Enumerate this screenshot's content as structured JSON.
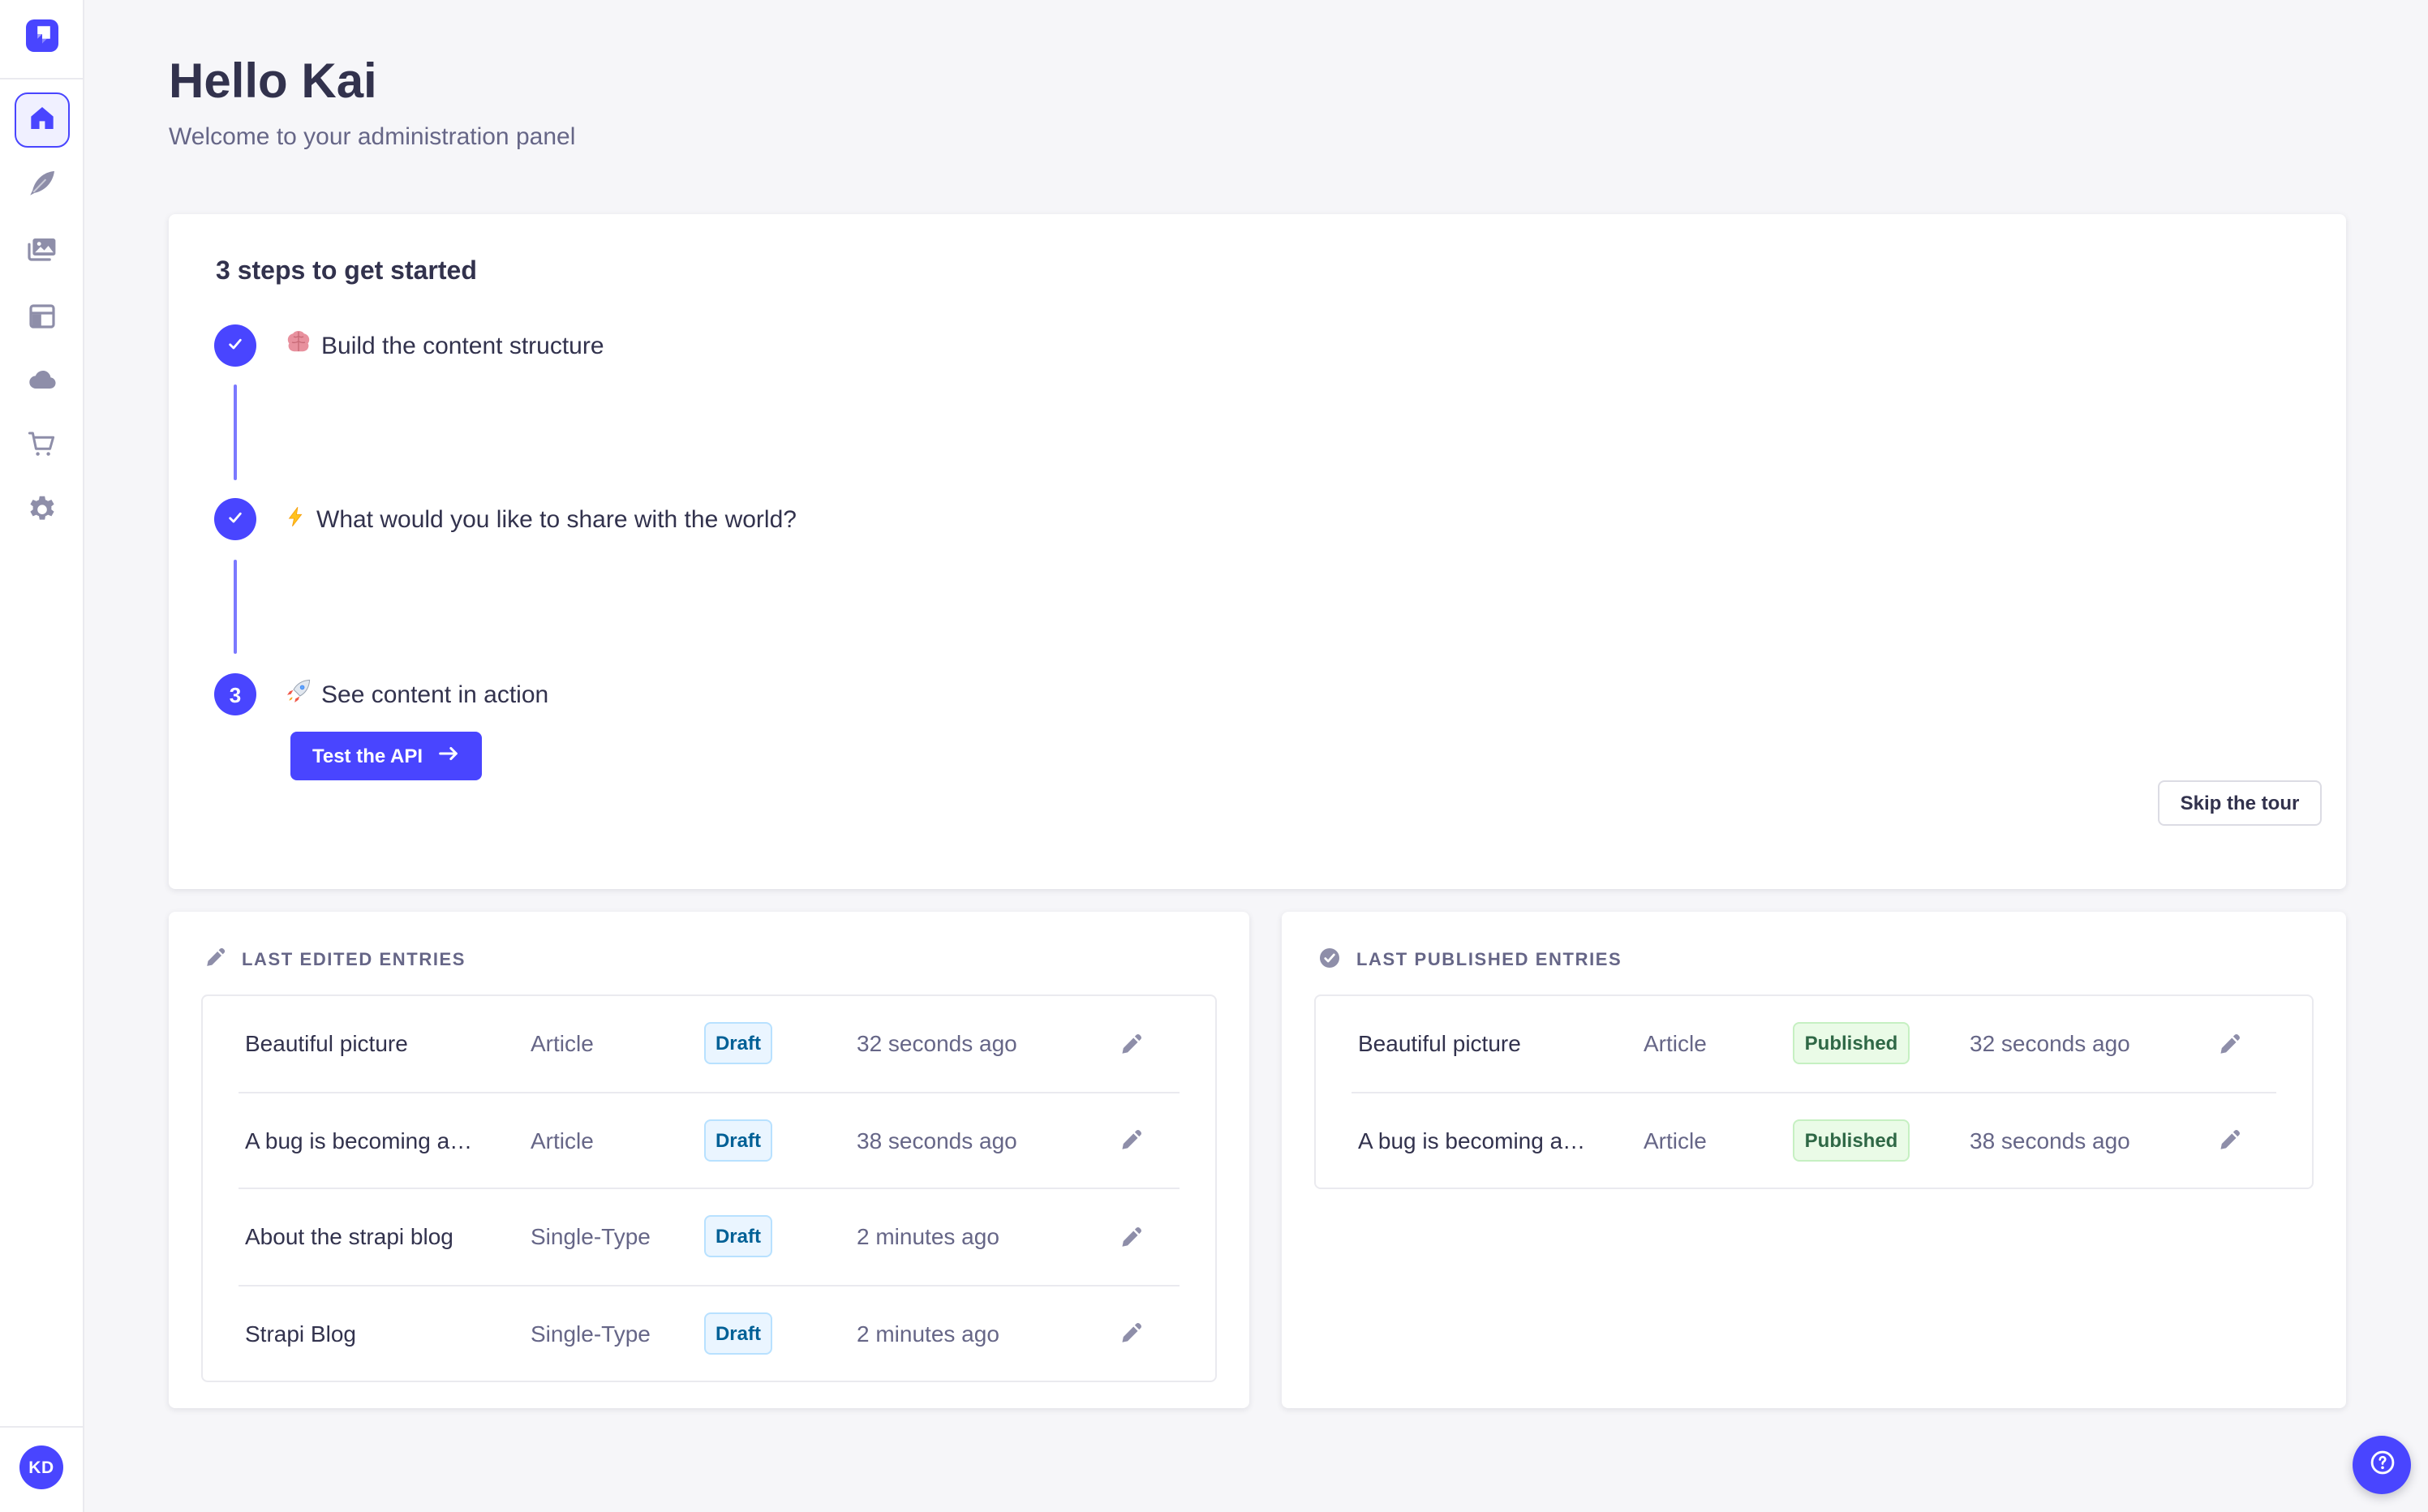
{
  "colors": {
    "primary": "#4945FF",
    "connector": "#7B79FF",
    "background": "#F6F6F9",
    "card": "#FFFFFF",
    "border": "#EAEAEF",
    "text_dark": "#32324D",
    "text_muted": "#666687",
    "icon_muted": "#8E8EA9",
    "draft_bg": "#EAF5FF",
    "draft_border": "#B8E1FF",
    "draft_text": "#006096",
    "published_bg": "#EAFBE7",
    "published_border": "#C6F0C2",
    "published_text": "#2F6846"
  },
  "sidebar": {
    "logo_icon": "strapi-logo-icon",
    "avatar_initials": "KD",
    "items": [
      {
        "icon": "home-icon",
        "active": true
      },
      {
        "icon": "feather-icon",
        "active": false
      },
      {
        "icon": "media-icon",
        "active": false
      },
      {
        "icon": "layout-icon",
        "active": false
      },
      {
        "icon": "cloud-icon",
        "active": false
      },
      {
        "icon": "cart-icon",
        "active": false
      },
      {
        "icon": "gear-icon",
        "active": false
      }
    ]
  },
  "header": {
    "title": "Hello Kai",
    "subtitle": "Welcome to your administration panel"
  },
  "onboarding": {
    "title": "3 steps to get started",
    "steps": [
      {
        "state": "done",
        "emoji": "🧠",
        "emoji_icon": "brain-emoji-icon",
        "label": "Build the content structure"
      },
      {
        "state": "done",
        "emoji": "⚡",
        "emoji_icon": "lightning-emoji-icon",
        "label": "What would you like to share with the world?"
      },
      {
        "state": "todo",
        "number": "3",
        "emoji": "🚀",
        "emoji_icon": "rocket-emoji-icon",
        "label": "See content in action"
      }
    ],
    "cta_label": "Test the API",
    "skip_label": "Skip the tour"
  },
  "last_edited": {
    "title": "LAST EDITED ENTRIES",
    "icon": "pencil-icon",
    "rows": [
      {
        "title": "Beautiful picture",
        "type": "Article",
        "status": "Draft",
        "time": "32 seconds ago"
      },
      {
        "title": "A bug is becoming a…",
        "type": "Article",
        "status": "Draft",
        "time": "38 seconds ago"
      },
      {
        "title": "About the strapi blog",
        "type": "Single-Type",
        "status": "Draft",
        "time": "2 minutes ago"
      },
      {
        "title": "Strapi Blog",
        "type": "Single-Type",
        "status": "Draft",
        "time": "2 minutes ago"
      }
    ]
  },
  "last_published": {
    "title": "LAST PUBLISHED ENTRIES",
    "icon": "check-circle-icon",
    "rows": [
      {
        "title": "Beautiful picture",
        "type": "Article",
        "status": "Published",
        "time": "32 seconds ago"
      },
      {
        "title": "A bug is becoming a…",
        "type": "Article",
        "status": "Published",
        "time": "38 seconds ago"
      }
    ]
  },
  "help": {
    "icon": "question-mark-icon"
  }
}
